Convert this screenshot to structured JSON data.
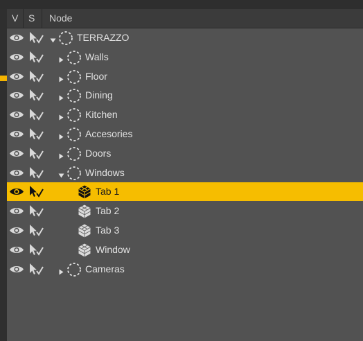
{
  "header": {
    "col_visibility": "V",
    "col_selectable": "S",
    "col_node": "Node"
  },
  "colors": {
    "selection": "#f6bd00",
    "panel": "#525252",
    "header": "#3b3b3b"
  },
  "tree": [
    {
      "label": "TERRAZZO",
      "depth": 0,
      "expander": "expanded",
      "icon": "group-node-icon",
      "selected": false
    },
    {
      "label": "Walls",
      "depth": 1,
      "expander": "collapsed",
      "icon": "group-node-icon",
      "selected": false
    },
    {
      "label": "Floor",
      "depth": 1,
      "expander": "collapsed",
      "icon": "group-node-icon",
      "selected": false
    },
    {
      "label": "Dining",
      "depth": 1,
      "expander": "collapsed",
      "icon": "group-node-icon",
      "selected": false
    },
    {
      "label": "Kitchen",
      "depth": 1,
      "expander": "collapsed",
      "icon": "group-node-icon",
      "selected": false
    },
    {
      "label": "Accesories",
      "depth": 1,
      "expander": "collapsed",
      "icon": "group-node-icon",
      "selected": false
    },
    {
      "label": "Doors",
      "depth": 1,
      "expander": "collapsed",
      "icon": "group-node-icon",
      "selected": false
    },
    {
      "label": "Windows",
      "depth": 1,
      "expander": "expanded",
      "icon": "group-node-icon",
      "selected": false
    },
    {
      "label": "Tab 1",
      "depth": 2,
      "expander": "none",
      "icon": "mesh-object-icon",
      "selected": true
    },
    {
      "label": "Tab 2",
      "depth": 2,
      "expander": "none",
      "icon": "mesh-object-icon",
      "selected": false
    },
    {
      "label": "Tab 3",
      "depth": 2,
      "expander": "none",
      "icon": "mesh-object-icon",
      "selected": false
    },
    {
      "label": "Window",
      "depth": 2,
      "expander": "none",
      "icon": "mesh-object-icon",
      "selected": false
    },
    {
      "label": "Cameras",
      "depth": 1,
      "expander": "collapsed",
      "icon": "group-node-icon",
      "selected": false
    }
  ]
}
